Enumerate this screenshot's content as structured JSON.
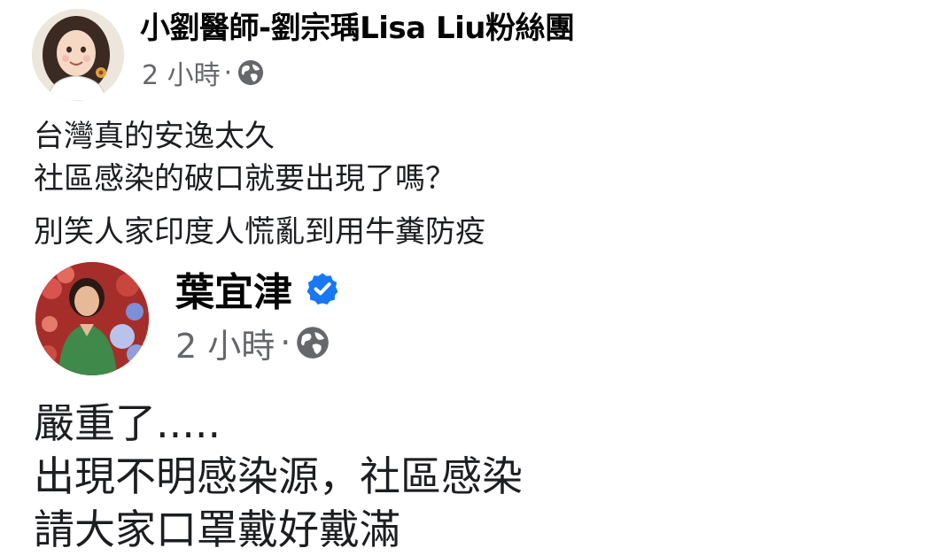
{
  "colors": {
    "text_primary": "#050505",
    "text_secondary": "#65676b",
    "verified_blue": "#1877f2",
    "background": "#ffffff"
  },
  "post1": {
    "author": "小劉醫師-劉宗瑀Lisa Liu粉絲團",
    "time": "2 小時",
    "separator": "·",
    "privacy_icon": "globe-icon",
    "lines": [
      "台灣真的安逸太久",
      "社區感染的破口就要出現了嗎？",
      "別笑人家印度人慌亂到用牛糞防疫"
    ]
  },
  "post2": {
    "author": "葉宜津",
    "verified_icon": "verified-badge-icon",
    "time": "2 小時",
    "separator": "·",
    "privacy_icon": "globe-icon",
    "lines": [
      "嚴重了.....",
      "出現不明感染源，社區感染",
      "請大家口罩戴好戴滿"
    ]
  }
}
